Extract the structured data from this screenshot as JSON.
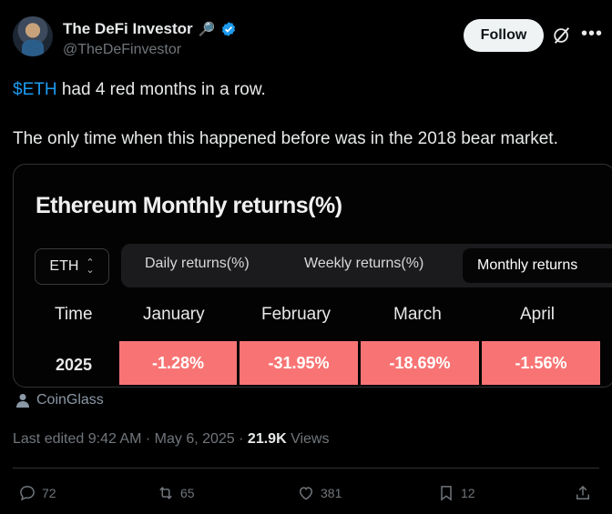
{
  "author": {
    "display_name": "The DeFi Investor",
    "handle": "@TheDeFinvestor",
    "name_emoji": "🔎"
  },
  "follow_label": "Follow",
  "tweet": {
    "cashtag": "$ETH",
    "line1_rest": " had 4 red months in a row.",
    "line2": "The only time when this happened before was in the 2018 bear market."
  },
  "card": {
    "title": "Ethereum Monthly returns(%)",
    "asset_select": "ETH",
    "tabs": [
      "Daily returns(%)",
      "Weekly returns(%)",
      "Monthly returns"
    ],
    "active_tab": 2,
    "table": {
      "headers": [
        "Time",
        "January",
        "February",
        "March",
        "April"
      ],
      "rows": [
        {
          "year": "2025",
          "values": [
            "-1.28%",
            "-31.95%",
            "-18.69%",
            "-1.56%"
          ]
        }
      ]
    },
    "negative_color": "#f87474"
  },
  "source_label": "CoinGlass",
  "meta": {
    "edited": "Last edited 9:42 AM · May 6, 2025 · ",
    "views_count": "21.9K",
    "views_label": " Views"
  },
  "actions": {
    "replies": "72",
    "reposts": "65",
    "likes": "381",
    "bookmarks": "12"
  },
  "colors": {
    "accent": "#1d9bf0",
    "background": "#000000"
  }
}
